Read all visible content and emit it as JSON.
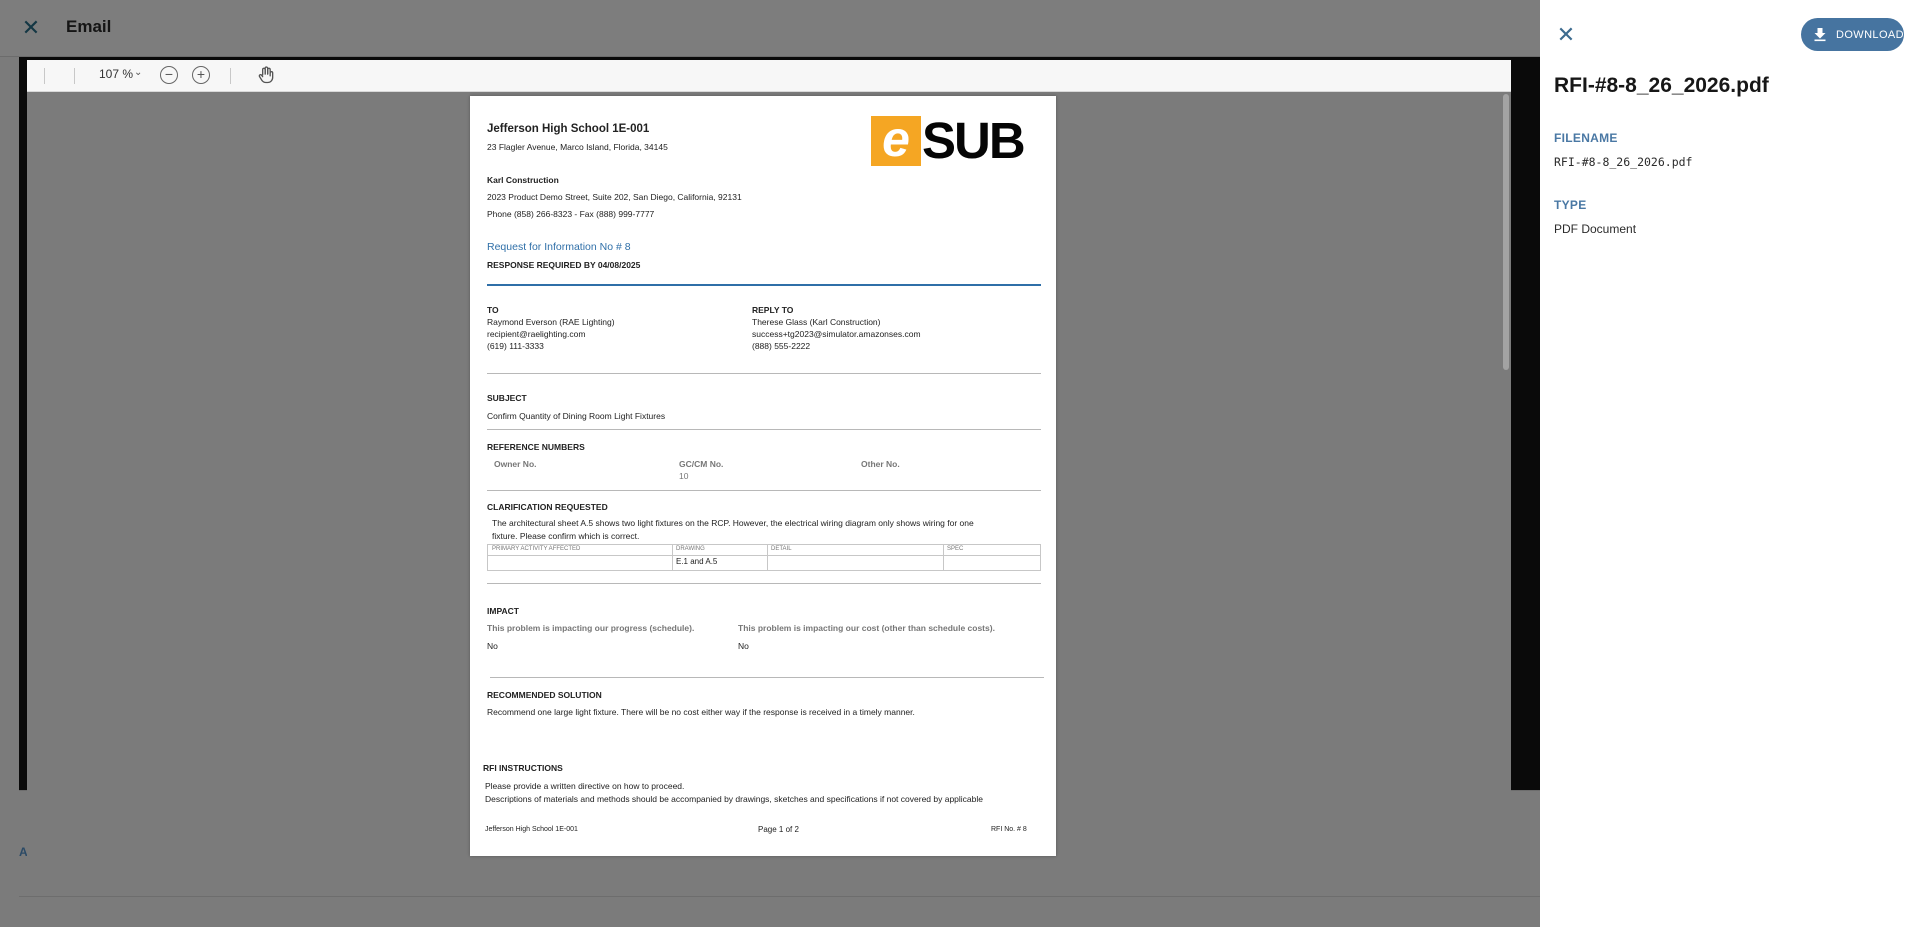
{
  "email": {
    "title": "Email",
    "close_icon": "close-icon",
    "footer_letter": "A"
  },
  "viewer": {
    "zoom": "107 %",
    "zoom_out_icon": "zoom-out-icon",
    "zoom_in_icon": "zoom-in-icon",
    "pan_icon": "hand-pan-icon",
    "zoom_out_glyph": "−",
    "zoom_in_glyph": "+"
  },
  "document": {
    "school": "Jefferson High School 1E-001",
    "school_address": "23 Flagler Avenue, Marco Island, Florida, 34145",
    "logo_e": "e",
    "logo_sub": "SUB",
    "company": "Karl Construction",
    "company_address": "2023 Product Demo Street, Suite 202, San Diego, California, 92131",
    "company_phone": "Phone (858) 266-8323 - Fax (888) 999-7777",
    "rfi_title": "Request for Information No # 8",
    "response_required": "RESPONSE REQUIRED BY 04/08/2025",
    "to_label": "TO",
    "to_name": "Raymond Everson (RAE Lighting)",
    "to_email": "recipient@raelighting.com",
    "to_phone": "(619) 111-3333",
    "reply_label": "REPLY TO",
    "reply_name": "Therese Glass (Karl Construction)",
    "reply_email": "success+tg2023@simulator.amazonses.com",
    "reply_phone": "(888) 555-2222",
    "subject_label": "SUBJECT",
    "subject": "Confirm Quantity of Dining Room Light Fixtures",
    "ref_label": "REFERENCE NUMBERS",
    "owner_no_label": "Owner No.",
    "gc_no_label": "GC/CM No.",
    "gc_no_value": "10",
    "other_no_label": "Other No.",
    "clarification_label": "CLARIFICATION REQUESTED",
    "clarification_line1": "The architectural sheet A.5 shows two light fixtures on the RCP. However, the electrical wiring diagram only shows wiring for one",
    "clarification_line2": "fixture. Please confirm which is correct.",
    "grid_primary": "PRIMARY ACTIVITY AFFECTED",
    "grid_drawing": "DRAWING",
    "grid_detail": "DETAIL",
    "grid_spec": "SPEC",
    "grid_drawing_value": "E.1 and A.5",
    "impact_label": "IMPACT",
    "impact_schedule_q": "This problem is impacting our progress (schedule).",
    "impact_schedule_a": "No",
    "impact_cost_q": "This problem is impacting our cost (other than schedule costs).",
    "impact_cost_a": "No",
    "solution_label": "RECOMMENDED SOLUTION",
    "solution": "Recommend one large light fixture. There will be no cost either way if the response is received in a timely manner.",
    "instructions_label": "RFI INSTRUCTIONS",
    "instructions_line1": "Please provide a written directive on how to proceed.",
    "instructions_line2": "Descriptions of materials and methods should be accompanied by drawings, sketches and specifications if not covered by applicable",
    "footer_left": "Jefferson High School 1E-001",
    "footer_center": "Page 1 of 2",
    "footer_right": "RFI No. # 8"
  },
  "side_panel": {
    "close_icon": "close-icon",
    "download_label": "DOWNLOAD",
    "file_title": "RFI-#8-8_26_2026.pdf",
    "filename_label": "FILENAME",
    "filename_value": "RFI-#8-8_26_2026.pdf",
    "type_label": "TYPE",
    "type_value": "PDF Document"
  },
  "colors": {
    "accent": "#4674a0",
    "link_blue": "#2f6fa8",
    "logo_orange": "#f5a623"
  }
}
